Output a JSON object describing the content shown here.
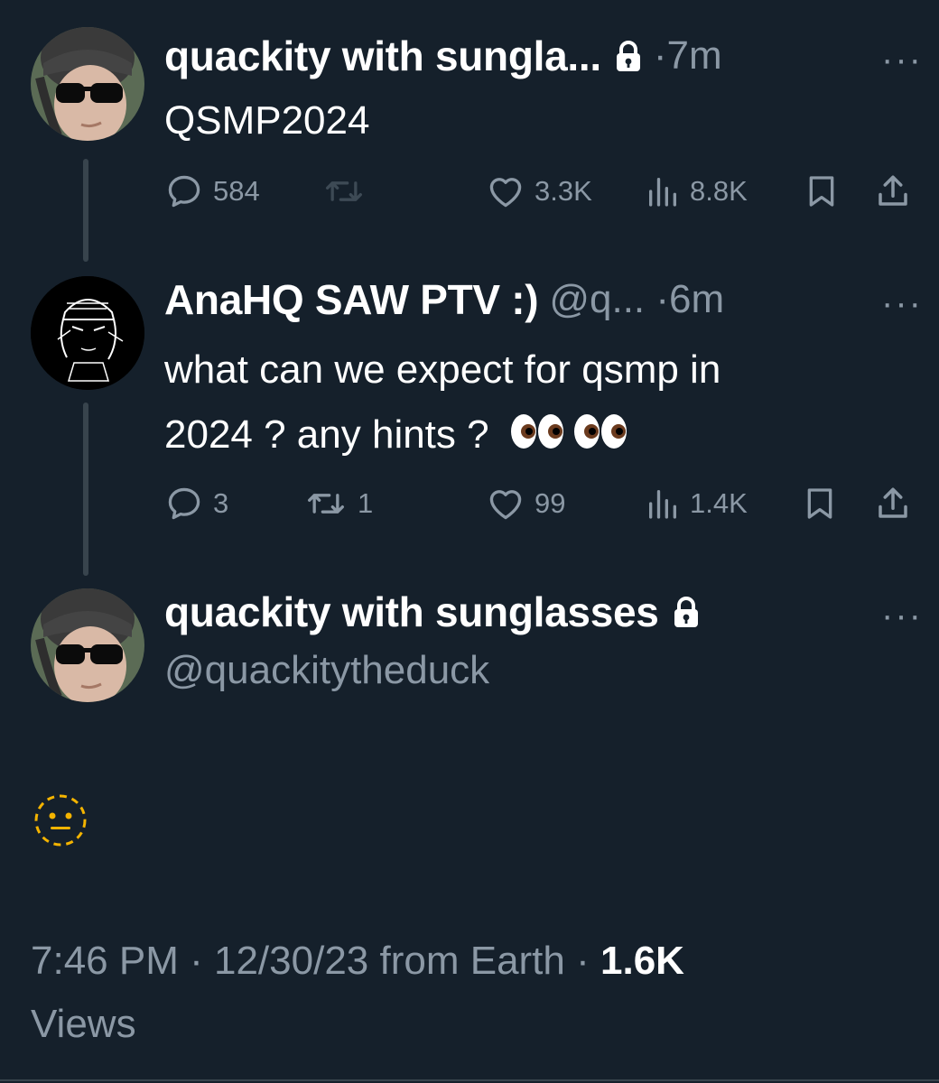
{
  "tweets": [
    {
      "display_name": "quackity with sungla...",
      "locked": true,
      "meta": "·7m",
      "more": "···",
      "text": "QSMP2024",
      "stats": {
        "replies": "584",
        "retweets": "",
        "likes": "3.3K",
        "views": "8.8K"
      }
    },
    {
      "display_name": "AnaHQ SAW PTV :)",
      "meta": "@q... ·6m",
      "more": "···",
      "text_line1": "what can we expect for qsmp in",
      "text_line2": "2024 ? any hints ?",
      "text_emoji": "👀👀",
      "stats": {
        "replies": "3",
        "retweets": "1",
        "likes": "99",
        "views": "1.4K"
      }
    }
  ],
  "main": {
    "display_name": "quackity with sunglasses",
    "locked": true,
    "more": "···",
    "handle": "@quackitytheduck",
    "text_emoji": "🫥"
  },
  "footer": {
    "time": "7:46 PM",
    "sep1": " · ",
    "date": "12/30/23",
    "from": " from Earth",
    "sep2": " · ",
    "views_count": "1.6K",
    "views_label": "Views"
  },
  "icons": {
    "reply": "reply-icon",
    "retweet": "retweet-icon",
    "like": "heart-icon",
    "views": "views-icon",
    "bookmark": "bookmark-icon",
    "share": "share-icon",
    "lock": "lock-icon",
    "more": "more-icon"
  },
  "colors": {
    "background": "#15202b",
    "secondary_text": "#8b98a5",
    "thread_line": "#38444d",
    "emoji_yellow": "#f4b400"
  }
}
